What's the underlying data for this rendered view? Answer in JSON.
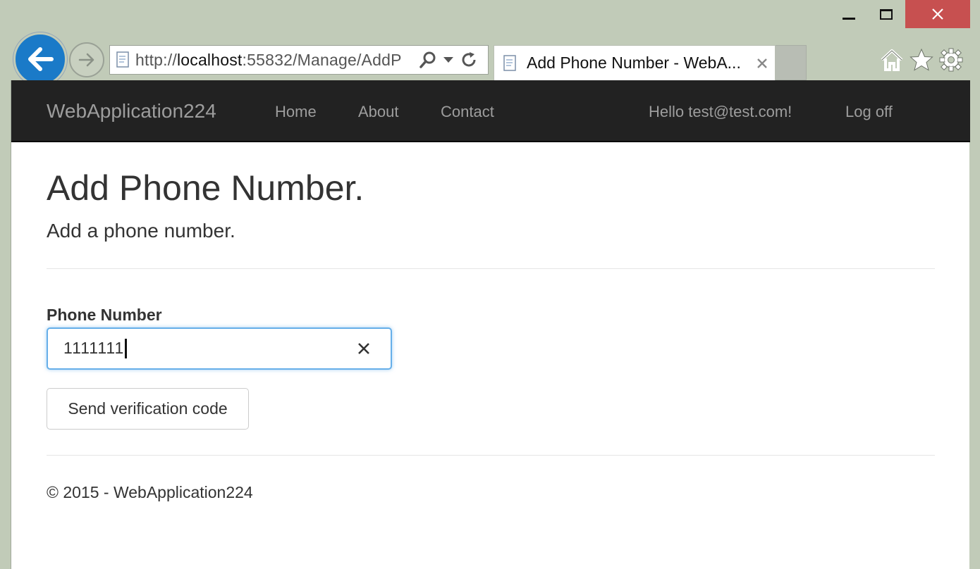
{
  "browser": {
    "address": {
      "scheme": "http://",
      "host": "localhost",
      "rest": ":55832/Manage/AddP"
    },
    "tab_title": "Add Phone Number - WebA...",
    "accent_color": "#1a7ac8",
    "close_color": "#c75050",
    "icons": [
      "back-arrow-icon",
      "forward-arrow-icon",
      "page-icon",
      "search-icon",
      "dropdown-icon",
      "refresh-icon",
      "close-icon",
      "home-icon",
      "favorites-star-icon",
      "gear-icon",
      "minimize-icon",
      "maximize-icon"
    ]
  },
  "navbar": {
    "brand": "WebApplication224",
    "links": [
      "Home",
      "About",
      "Contact"
    ],
    "greeting": "Hello test@test.com!",
    "logoff": "Log off"
  },
  "page": {
    "title": "Add Phone Number.",
    "subtitle": "Add a phone number.",
    "field_label": "Phone Number",
    "phone_value": "1111111",
    "submit_label": "Send verification code",
    "footer": "© 2015 - WebApplication224"
  }
}
